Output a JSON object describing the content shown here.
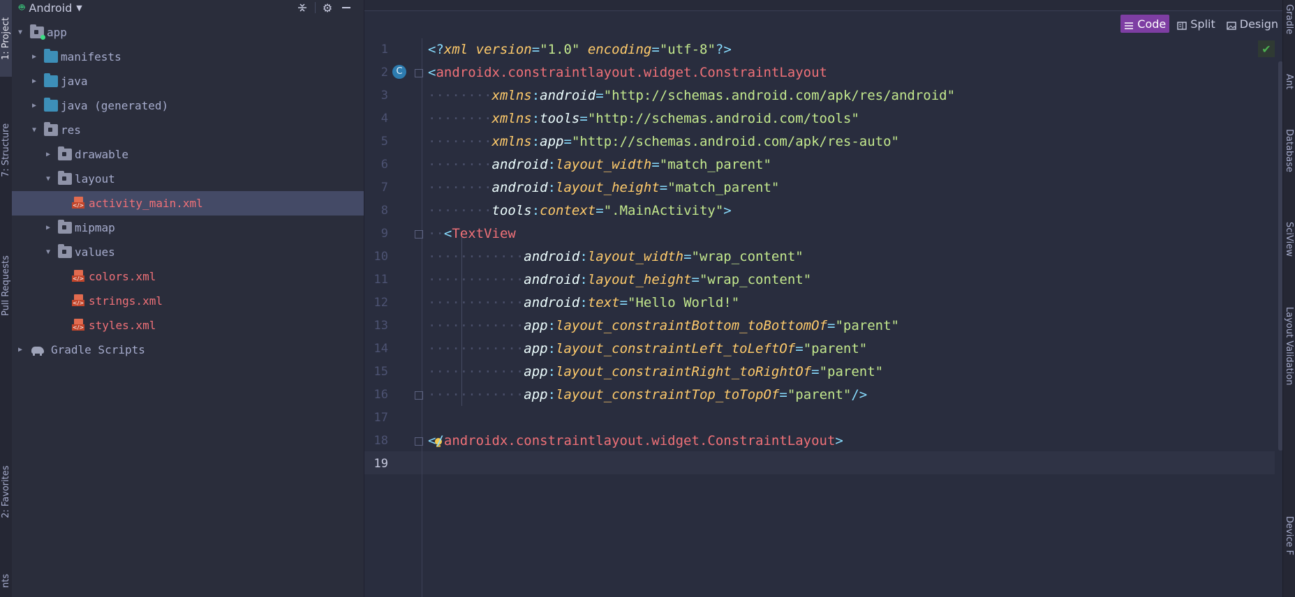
{
  "left_strip": {
    "tabs": [
      {
        "label": "1: Project",
        "active": true
      },
      {
        "label": "7: Structure",
        "active": false
      },
      {
        "label": "Pull Requests",
        "active": false
      },
      {
        "label": "2: Favorites",
        "active": false
      },
      {
        "label": "nts",
        "active": false
      }
    ]
  },
  "right_strip": {
    "tabs": [
      "Gradle",
      "Ant",
      "Database",
      "SciView",
      "Layout Validation",
      "Device F"
    ]
  },
  "project": {
    "view_selector": "Android",
    "header_icons": [
      "collapse-all-icon",
      "gear-icon",
      "minimize-icon"
    ],
    "tree": [
      {
        "label": "app",
        "depth": 0,
        "expand": "open",
        "icon": "module-folder",
        "style": "normal"
      },
      {
        "label": "manifests",
        "depth": 1,
        "expand": "closed",
        "icon": "folder-blue",
        "style": "normal"
      },
      {
        "label": "java",
        "depth": 1,
        "expand": "closed",
        "icon": "folder-blue",
        "style": "normal"
      },
      {
        "label": "java (generated)",
        "depth": 1,
        "expand": "closed",
        "icon": "folder-blue",
        "style": "normal"
      },
      {
        "label": "res",
        "depth": 1,
        "expand": "open",
        "icon": "folder-res",
        "style": "normal"
      },
      {
        "label": "drawable",
        "depth": 2,
        "expand": "closed",
        "icon": "folder-grey",
        "style": "normal"
      },
      {
        "label": "layout",
        "depth": 2,
        "expand": "open",
        "icon": "folder-grey",
        "style": "normal"
      },
      {
        "label": "activity_main.xml",
        "depth": 3,
        "expand": "none",
        "icon": "xml",
        "style": "red",
        "selected": true
      },
      {
        "label": "mipmap",
        "depth": 2,
        "expand": "closed",
        "icon": "folder-grey",
        "style": "normal"
      },
      {
        "label": "values",
        "depth": 2,
        "expand": "open",
        "icon": "folder-grey",
        "style": "normal"
      },
      {
        "label": "colors.xml",
        "depth": 3,
        "expand": "none",
        "icon": "xml",
        "style": "red"
      },
      {
        "label": "strings.xml",
        "depth": 3,
        "expand": "none",
        "icon": "xml",
        "style": "red"
      },
      {
        "label": "styles.xml",
        "depth": 3,
        "expand": "none",
        "icon": "xml",
        "style": "red"
      },
      {
        "label": "Gradle Scripts",
        "depth": 0,
        "expand": "closed",
        "icon": "gradle",
        "style": "normal"
      }
    ]
  },
  "editor": {
    "modes": [
      {
        "label": "Code",
        "active": true
      },
      {
        "label": "Split",
        "active": false
      },
      {
        "label": "Design",
        "active": false
      }
    ],
    "current_line": 19,
    "lines": [
      {
        "n": "1",
        "indent": 0,
        "tokens": [
          [
            "pun",
            "<?"
          ],
          [
            "ns",
            "xml "
          ],
          [
            "attrI",
            "version"
          ],
          [
            "pun",
            "="
          ],
          [
            "str",
            "\"1.0\""
          ],
          [
            "plain",
            " "
          ],
          [
            "attrI",
            "encoding"
          ],
          [
            "pun",
            "="
          ],
          [
            "str",
            "\"utf-8\""
          ],
          [
            "pun",
            "?>"
          ]
        ]
      },
      {
        "n": "2",
        "indent": 0,
        "tokens": [
          [
            "pun",
            "<"
          ],
          [
            "tag",
            "androidx.constraintlayout.widget.ConstraintLayout"
          ]
        ]
      },
      {
        "n": "3",
        "indent": 2,
        "tokens": [
          [
            "ns",
            "xmlns"
          ],
          [
            "pun",
            ":"
          ],
          [
            "plain",
            "android"
          ],
          [
            "pun",
            "="
          ],
          [
            "str",
            "\"http://schemas.android.com/apk/res/android\""
          ]
        ]
      },
      {
        "n": "4",
        "indent": 2,
        "tokens": [
          [
            "ns",
            "xmlns"
          ],
          [
            "pun",
            ":"
          ],
          [
            "plain",
            "tools"
          ],
          [
            "pun",
            "="
          ],
          [
            "str",
            "\"http://schemas.android.com/tools\""
          ]
        ]
      },
      {
        "n": "5",
        "indent": 2,
        "tokens": [
          [
            "ns",
            "xmlns"
          ],
          [
            "pun",
            ":"
          ],
          [
            "plain",
            "app"
          ],
          [
            "pun",
            "="
          ],
          [
            "str",
            "\"http://schemas.android.com/apk/res-auto\""
          ]
        ]
      },
      {
        "n": "6",
        "indent": 2,
        "tokens": [
          [
            "plain",
            "android"
          ],
          [
            "pun",
            ":"
          ],
          [
            "attrI",
            "layout_width"
          ],
          [
            "pun",
            "="
          ],
          [
            "str",
            "\"match_parent\""
          ]
        ]
      },
      {
        "n": "7",
        "indent": 2,
        "tokens": [
          [
            "plain",
            "android"
          ],
          [
            "pun",
            ":"
          ],
          [
            "attrI",
            "layout_height"
          ],
          [
            "pun",
            "="
          ],
          [
            "str",
            "\"match_parent\""
          ]
        ]
      },
      {
        "n": "8",
        "indent": 2,
        "tokens": [
          [
            "plain",
            "tools"
          ],
          [
            "pun",
            ":"
          ],
          [
            "attrI",
            "context"
          ],
          [
            "pun",
            "="
          ],
          [
            "str",
            "\".MainActivity\""
          ],
          [
            "pun",
            ">"
          ]
        ]
      },
      {
        "n": "9",
        "indent": 1,
        "tokens": [
          [
            "pun",
            "<"
          ],
          [
            "tag",
            "TextView"
          ]
        ]
      },
      {
        "n": "10",
        "indent": 3,
        "tokens": [
          [
            "plain",
            "android"
          ],
          [
            "pun",
            ":"
          ],
          [
            "attrI",
            "layout_width"
          ],
          [
            "pun",
            "="
          ],
          [
            "str",
            "\"wrap_content\""
          ]
        ]
      },
      {
        "n": "11",
        "indent": 3,
        "tokens": [
          [
            "plain",
            "android"
          ],
          [
            "pun",
            ":"
          ],
          [
            "attrI",
            "layout_height"
          ],
          [
            "pun",
            "="
          ],
          [
            "str",
            "\"wrap_content\""
          ]
        ]
      },
      {
        "n": "12",
        "indent": 3,
        "tokens": [
          [
            "plain",
            "android"
          ],
          [
            "pun",
            ":"
          ],
          [
            "attrI",
            "text"
          ],
          [
            "pun",
            "="
          ],
          [
            "str",
            "\"Hello World!\""
          ]
        ]
      },
      {
        "n": "13",
        "indent": 3,
        "tokens": [
          [
            "plain",
            "app"
          ],
          [
            "pun",
            ":"
          ],
          [
            "attrI",
            "layout_constraintBottom_toBottomOf"
          ],
          [
            "pun",
            "="
          ],
          [
            "str",
            "\"parent\""
          ]
        ]
      },
      {
        "n": "14",
        "indent": 3,
        "tokens": [
          [
            "plain",
            "app"
          ],
          [
            "pun",
            ":"
          ],
          [
            "attrI",
            "layout_constraintLeft_toLeftOf"
          ],
          [
            "pun",
            "="
          ],
          [
            "str",
            "\"parent\""
          ]
        ]
      },
      {
        "n": "15",
        "indent": 3,
        "tokens": [
          [
            "plain",
            "app"
          ],
          [
            "pun",
            ":"
          ],
          [
            "attrI",
            "layout_constraintRight_toRightOf"
          ],
          [
            "pun",
            "="
          ],
          [
            "str",
            "\"parent\""
          ]
        ]
      },
      {
        "n": "16",
        "indent": 3,
        "tokens": [
          [
            "plain",
            "app"
          ],
          [
            "pun",
            ":"
          ],
          [
            "attrI",
            "layout_constraintTop_toTopOf"
          ],
          [
            "pun",
            "="
          ],
          [
            "str",
            "\"parent\""
          ],
          [
            "pun",
            "/>"
          ]
        ]
      },
      {
        "n": "17",
        "indent": 0,
        "tokens": []
      },
      {
        "n": "18",
        "indent": 0,
        "tokens": [
          [
            "pun",
            "</"
          ],
          [
            "tag",
            "androidx.constraintlayout.widget.ConstraintLayout"
          ],
          [
            "pun",
            ">"
          ]
        ]
      },
      {
        "n": "19",
        "indent": 0,
        "tokens": []
      }
    ],
    "badge_letter": "C",
    "colors": {
      "background": "#292d3e",
      "punctuation": "#89ddff",
      "tag": "#f07178",
      "attribute": "#ffcb6b",
      "string": "#c3e88d",
      "active_mode": "#7e3ea3"
    }
  }
}
